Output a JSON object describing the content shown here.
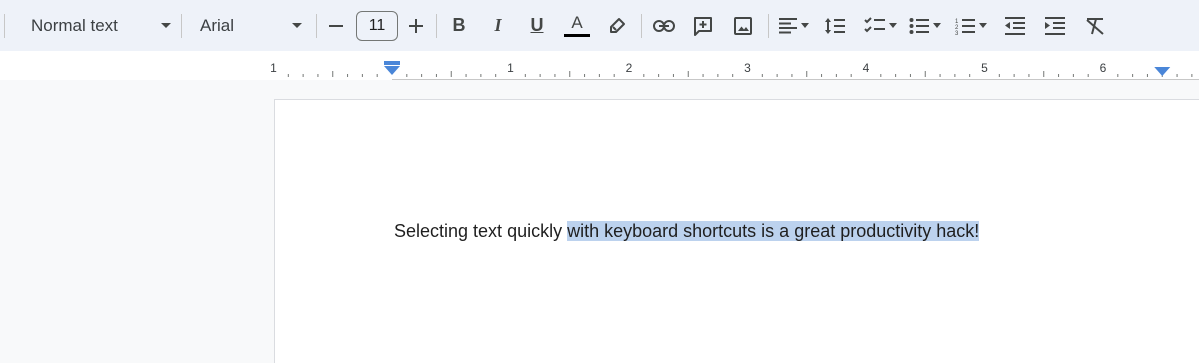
{
  "toolbar": {
    "paragraph_style": "Normal text",
    "font_family": "Arial",
    "font_size": "11",
    "icons": [
      "decrease-font-size-icon",
      "increase-font-size-icon",
      "bold-icon",
      "italic-icon",
      "underline-icon",
      "text-color-icon",
      "highlight-icon",
      "link-icon",
      "comment-icon",
      "image-icon",
      "align-left-icon",
      "line-spacing-icon",
      "checklist-icon",
      "bulleted-list-icon",
      "numbered-list-icon",
      "decrease-indent-icon",
      "increase-indent-icon",
      "clear-formatting-icon"
    ],
    "bold_label": "B",
    "italic_label": "I",
    "underline_label": "U",
    "text_color_label": "A",
    "text_color": "#000000"
  },
  "ruler": {
    "numbers": [
      "1",
      "1",
      "2",
      "3",
      "4",
      "5",
      "6"
    ],
    "marker_color": "#4a86d8"
  },
  "document": {
    "plain_text": "Selecting text quickly ",
    "selected_text": "with keyboard shortcuts is a great productivity hack!",
    "selection_color": "#bcd2ee"
  }
}
